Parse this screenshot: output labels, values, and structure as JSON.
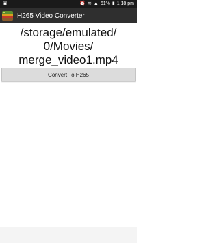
{
  "status_bar": {
    "battery": "61%",
    "time": "1:18 pm",
    "icons": [
      "image-icon",
      "alarm-icon",
      "wifi-icon",
      "signal-icon",
      "battery-icon"
    ]
  },
  "app_bar": {
    "title": "H265 Video Converter",
    "icon": "app-icon"
  },
  "main": {
    "path_lines": [
      "/storage/emulated/",
      "0/Movies/",
      "merge_video1.mp4"
    ],
    "convert_label": "Convert To H265"
  },
  "colors": {
    "status_bar_bg": "#1a1a1a",
    "app_bar_bg": "#2f2f2f",
    "button_bg": "#dcdcdc"
  }
}
